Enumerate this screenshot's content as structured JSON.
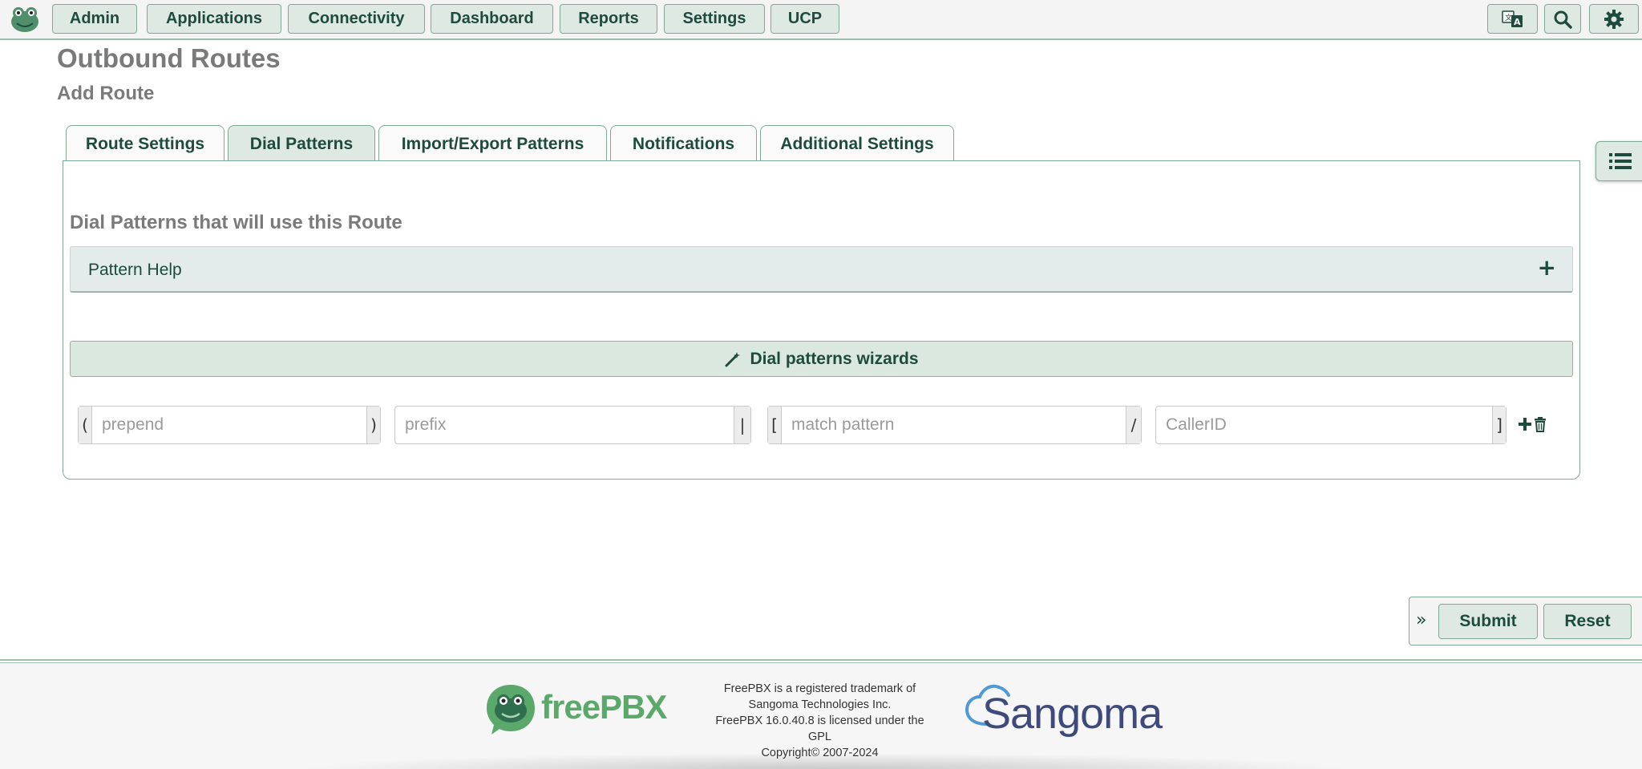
{
  "nav": {
    "items": [
      "Admin",
      "Applications",
      "Connectivity",
      "Dashboard",
      "Reports",
      "Settings",
      "UCP"
    ],
    "right_icons": [
      "translate-icon",
      "search-icon",
      "gear-icon"
    ]
  },
  "page": {
    "title": "Outbound Routes",
    "subtitle": "Add Route"
  },
  "tabs": [
    {
      "label": "Route Settings",
      "active": false
    },
    {
      "label": "Dial Patterns",
      "active": true
    },
    {
      "label": "Import/Export Patterns",
      "active": false
    },
    {
      "label": "Notifications",
      "active": false
    },
    {
      "label": "Additional Settings",
      "active": false
    }
  ],
  "dial_patterns": {
    "section_title": "Dial Patterns that will use this Route",
    "help_label": "Pattern Help",
    "help_expand": "+",
    "wizard_label": "Dial patterns wizards",
    "row": {
      "prepend_open": "(",
      "prepend_placeholder": "prepend",
      "prepend_close": ")",
      "prefix_placeholder": "prefix",
      "prefix_sep": "|",
      "match_open": "[",
      "match_placeholder": "match pattern",
      "match_sep": "/",
      "callerid_placeholder": "CallerID",
      "callerid_close": "]"
    }
  },
  "actions": {
    "toggle": "»",
    "submit": "Submit",
    "reset": "Reset"
  },
  "footer": {
    "brand": "freePBX",
    "legal_lines": [
      "FreePBX is a registered trademark of",
      "Sangoma Technologies Inc.",
      "FreePBX 16.0.40.8 is licensed under the",
      "GPL",
      "Copyright© 2007-2024"
    ],
    "partner": "Sangoma"
  },
  "colors": {
    "accent": "#1d4b3e",
    "button_bg": "#dfe9e3",
    "border": "#7fa995",
    "brand_green": "#5aa86a",
    "sangoma_blue": "#3e4a7c"
  }
}
